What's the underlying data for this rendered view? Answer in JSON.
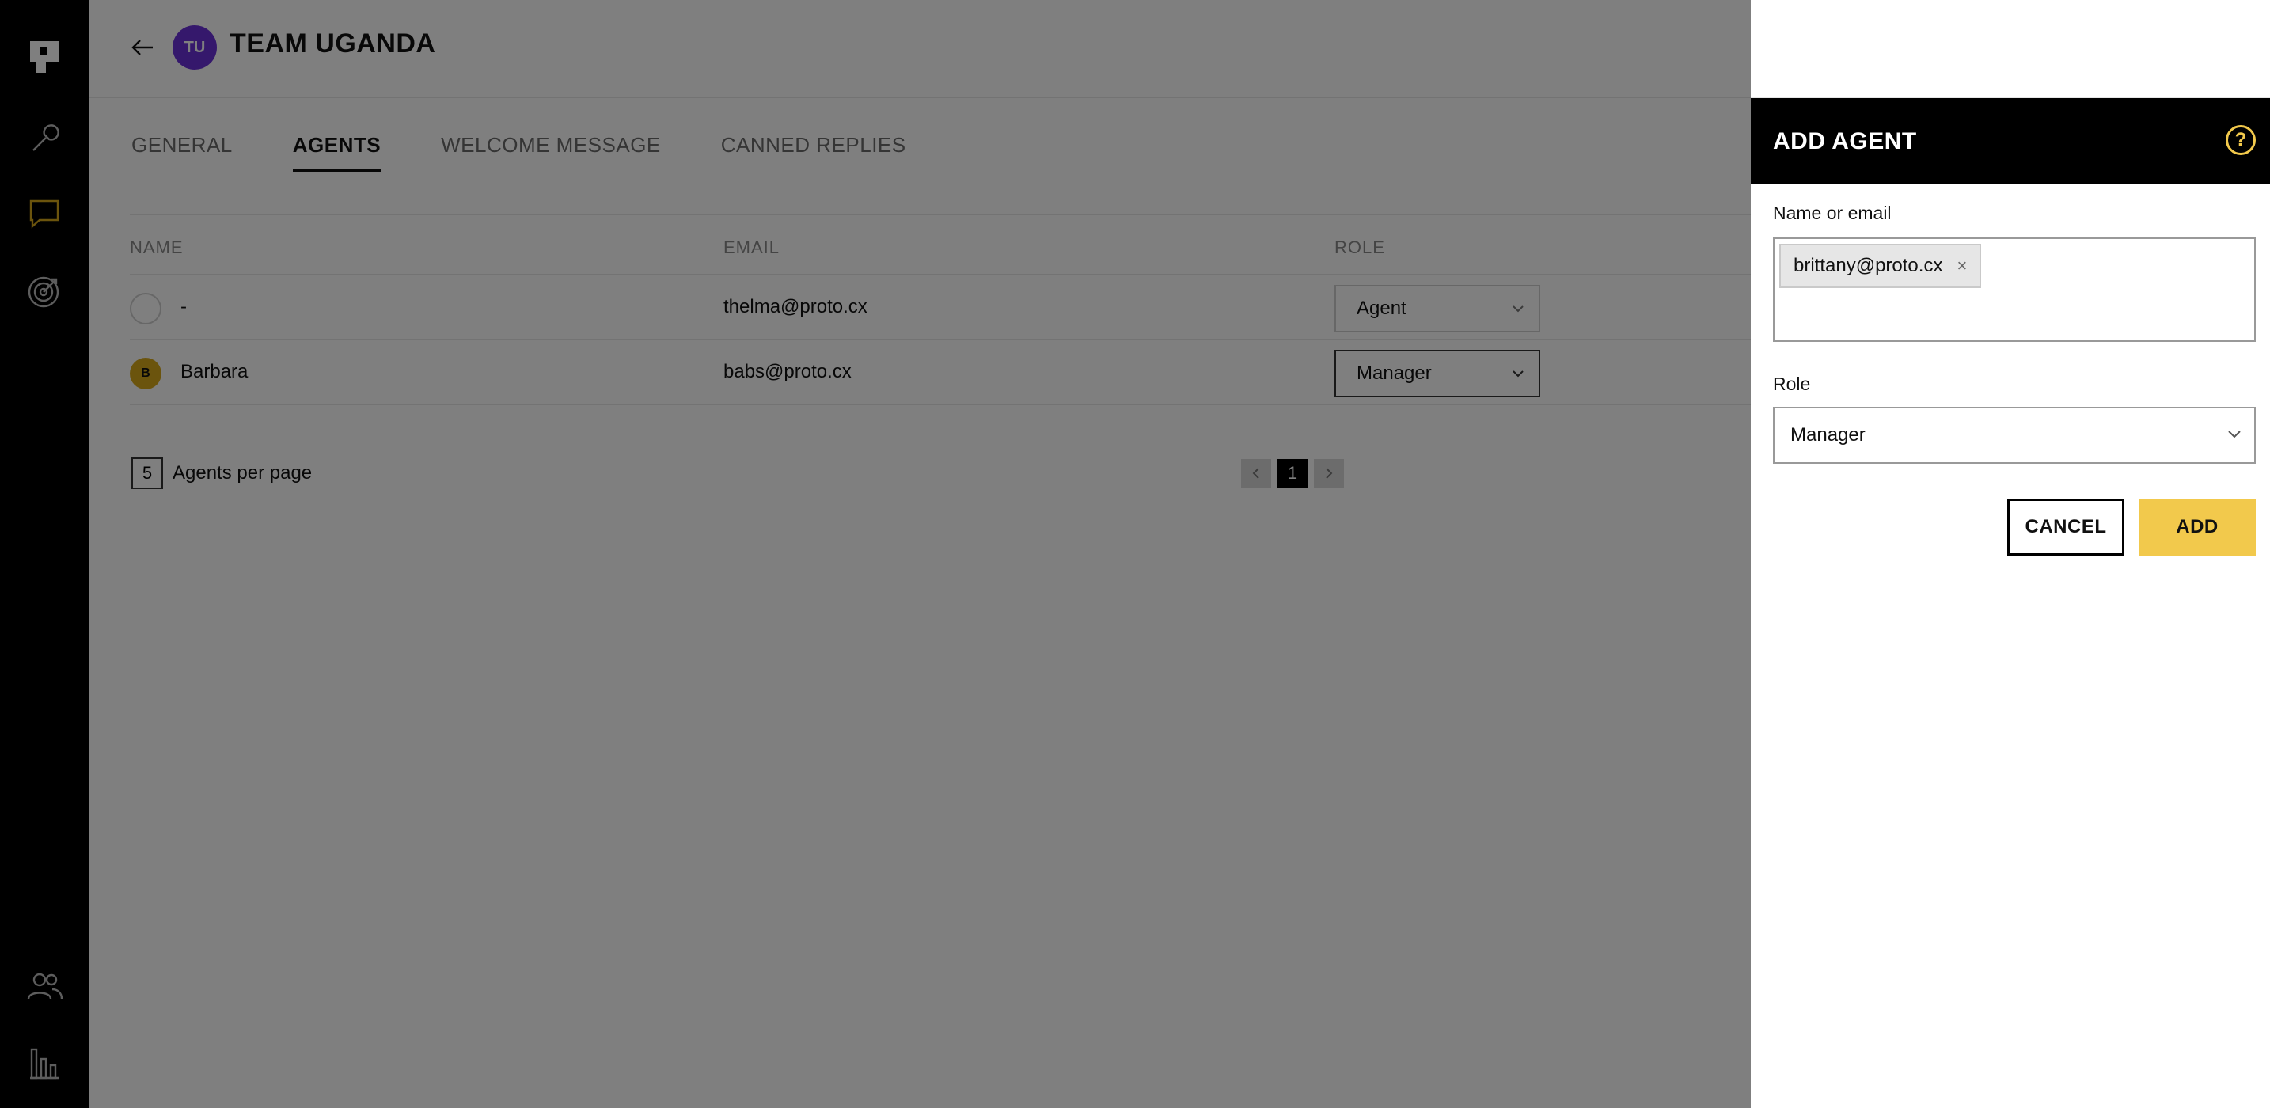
{
  "header": {
    "team_initials": "TU",
    "team_name": "TEAM UGANDA"
  },
  "tabs": [
    {
      "label": "GENERAL"
    },
    {
      "label": "AGENTS",
      "active": true
    },
    {
      "label": "WELCOME MESSAGE"
    },
    {
      "label": "CANNED REPLIES"
    }
  ],
  "table": {
    "headers": {
      "name": "NAME",
      "email": "EMAIL",
      "role": "ROLE"
    },
    "rows": [
      {
        "name": "-",
        "email": "thelma@proto.cx",
        "role": "Agent"
      },
      {
        "initial": "B",
        "name": "Barbara",
        "email": "babs@proto.cx",
        "role": "Manager"
      }
    ]
  },
  "pagination": {
    "per_page": "5",
    "per_page_label": "Agents per page",
    "current_page": "1"
  },
  "panel": {
    "title": "ADD AGENT",
    "help_glyph": "?",
    "name_label": "Name or email",
    "chip_value": "brittany@proto.cx",
    "chip_remove": "×",
    "role_label": "Role",
    "role_value": "Manager",
    "cancel_label": "CANCEL",
    "add_label": "ADD"
  },
  "colors": {
    "accent": "#f2c94c",
    "team_avatar": "#6a31d8",
    "rail": "#000000"
  },
  "icons": {
    "rail": [
      "logo-icon",
      "wrench-icon",
      "chat-icon",
      "target-icon",
      "users-icon",
      "bar-chart-icon"
    ]
  }
}
